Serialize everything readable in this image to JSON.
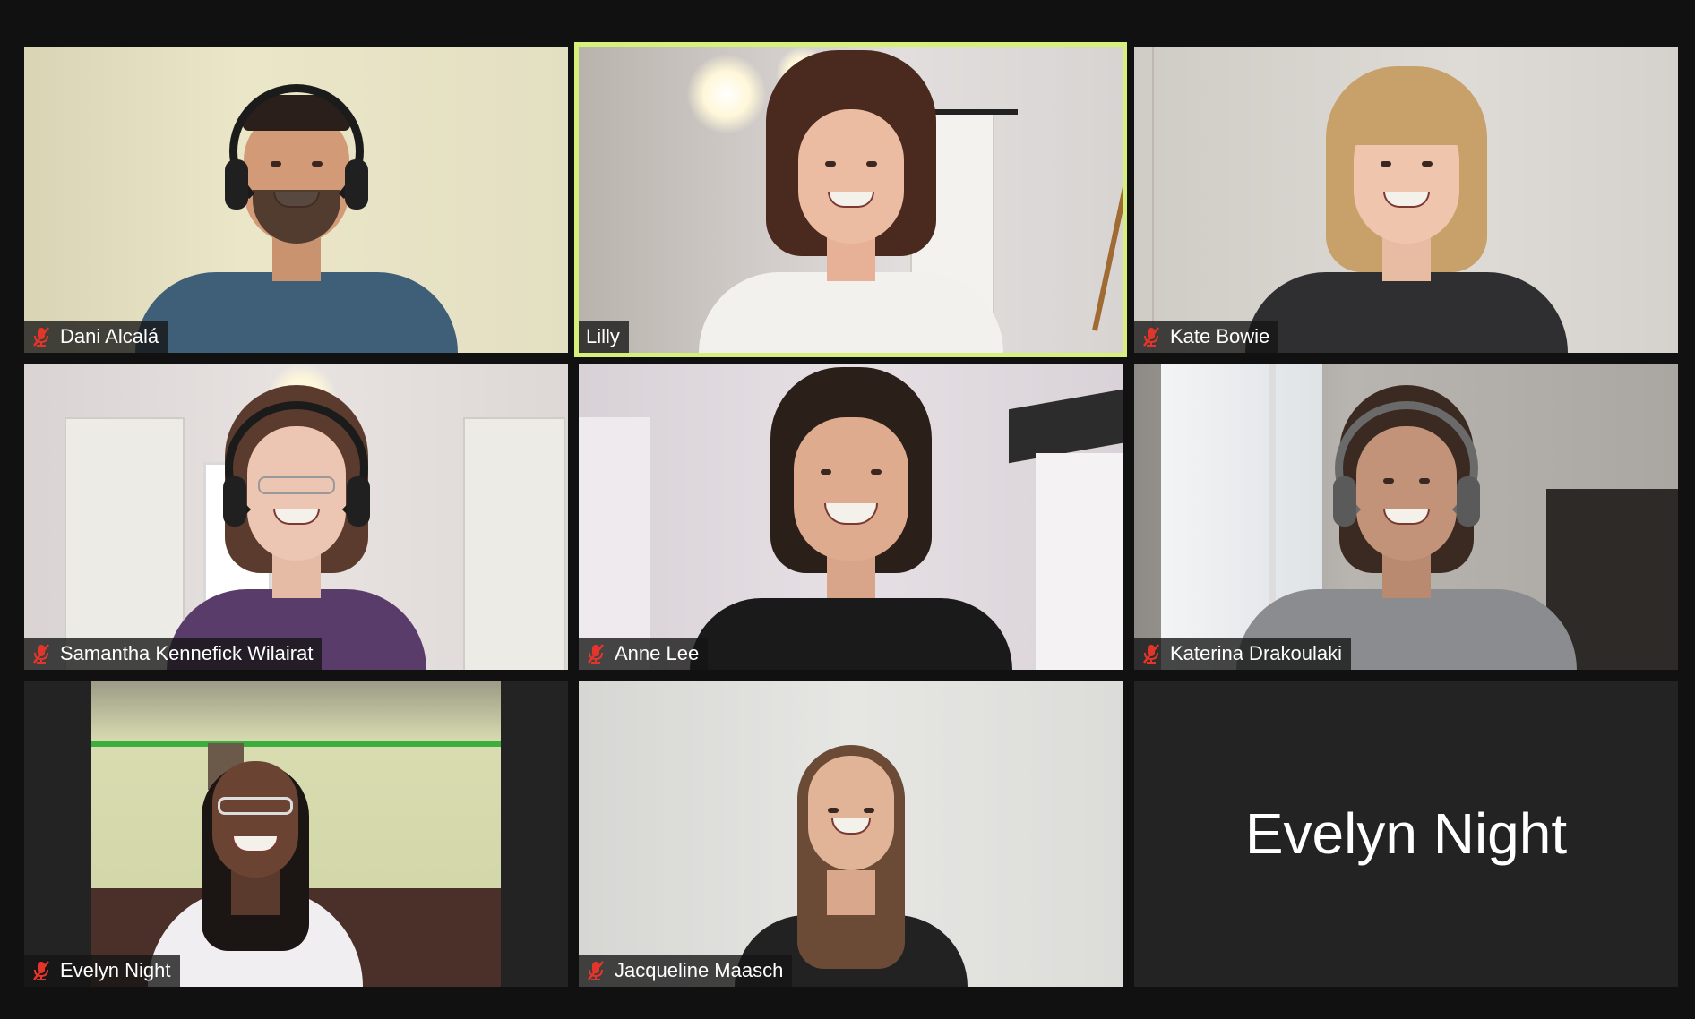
{
  "participants": [
    {
      "name": "Dani Alcalá",
      "muted": true,
      "active": false
    },
    {
      "name": "Lilly",
      "muted": false,
      "active": true
    },
    {
      "name": "Kate Bowie",
      "muted": true,
      "active": false
    },
    {
      "name": "Samantha Kennefick Wilairat",
      "muted": true,
      "active": false
    },
    {
      "name": "Anne Lee",
      "muted": true,
      "active": false
    },
    {
      "name": "Katerina Drakoulaki",
      "muted": true,
      "active": false
    },
    {
      "name": "Evelyn Night",
      "muted": true,
      "active": false
    },
    {
      "name": "Jacqueline Maasch",
      "muted": true,
      "active": false
    },
    {
      "name": "Evelyn Night",
      "muted": false,
      "active": false,
      "video_off": true
    }
  ],
  "colors": {
    "background": "#111111",
    "active_speaker_border": "#d7f07a",
    "mic_off": "#e5352b",
    "tile_off": "#232323"
  },
  "icons": {
    "muted": "mic-off-icon"
  }
}
